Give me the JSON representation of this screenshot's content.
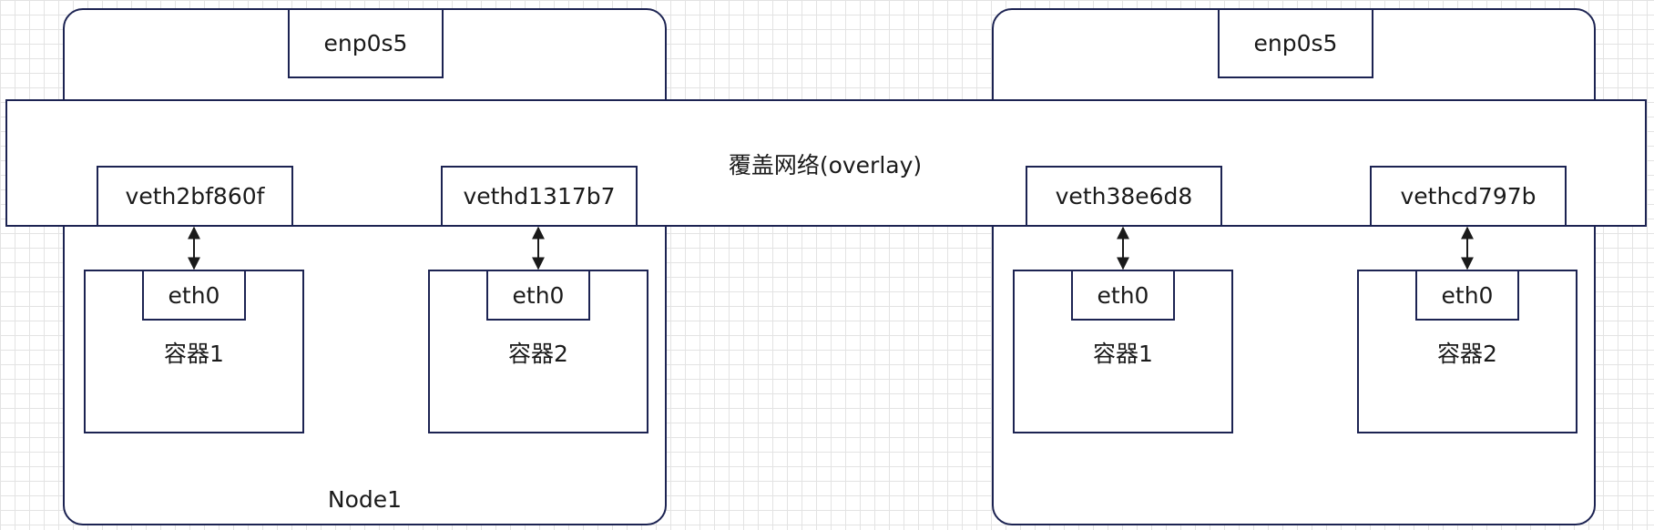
{
  "overlay": {
    "label": "覆盖网络(overlay)"
  },
  "nodes": [
    {
      "label": "Node1",
      "nic": "enp0s5",
      "veths": [
        "veth2bf860f",
        "vethd1317b7"
      ],
      "containers": [
        {
          "iface": "eth0",
          "name": "容器1"
        },
        {
          "iface": "eth0",
          "name": "容器2"
        }
      ]
    },
    {
      "label": "",
      "nic": "enp0s5",
      "veths": [
        "veth38e6d8",
        "vethcd797b"
      ],
      "containers": [
        {
          "iface": "eth0",
          "name": "容器1"
        },
        {
          "iface": "eth0",
          "name": "容器2"
        }
      ]
    }
  ],
  "colors": {
    "stroke": "#1c2352",
    "grid": "#e3e3e3",
    "text": "#1a1a1a"
  }
}
